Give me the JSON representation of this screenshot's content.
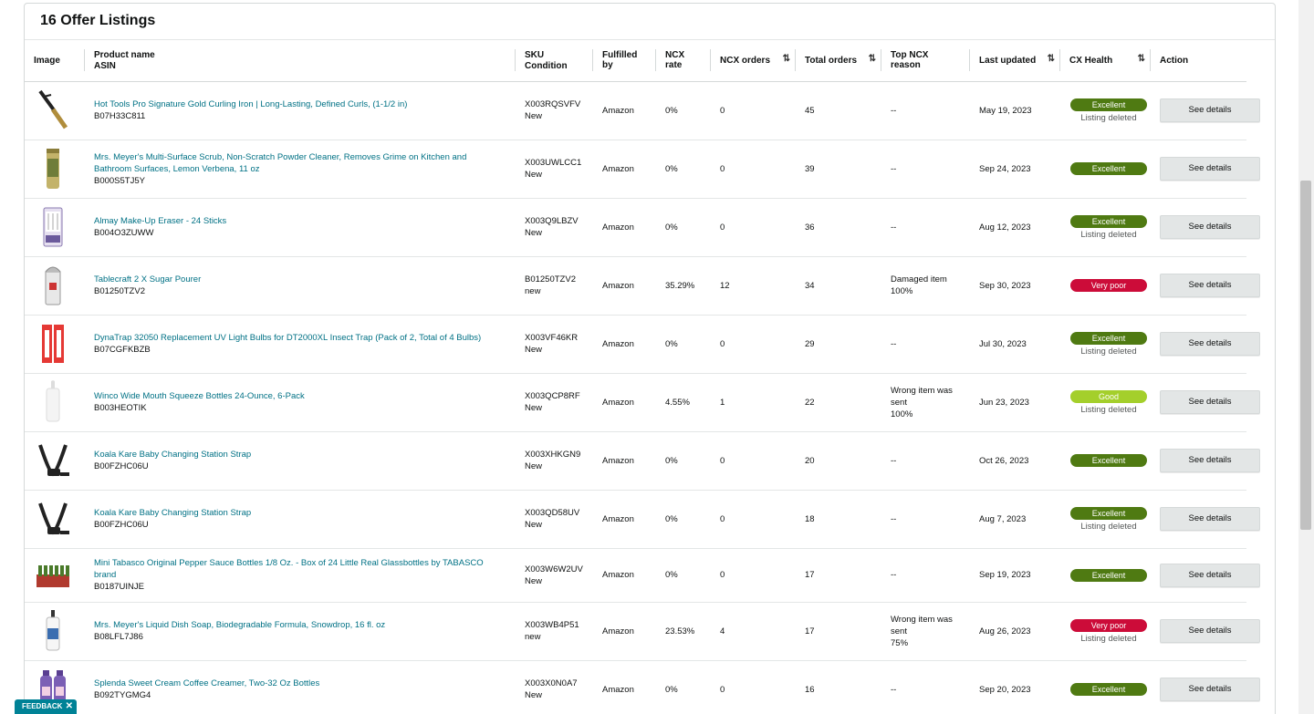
{
  "panel": {
    "title": "16 Offer Listings"
  },
  "columns": {
    "image": "Image",
    "product_name": "Product name",
    "asin": "ASIN",
    "sku": "SKU",
    "condition": "Condition",
    "fulfilled_by": "Fulfilled by",
    "ncx_rate": "NCX rate",
    "ncx_orders": "NCX orders",
    "total_orders": "Total orders",
    "top_ncx_reason": "Top NCX reason",
    "last_updated": "Last updated",
    "cx_health": "CX Health",
    "action": "Action",
    "sort_icon": "⇅"
  },
  "rows": [
    {
      "image_icon": "curling-iron",
      "name": "Hot Tools Pro Signature Gold Curling Iron | Long-Lasting, Defined Curls, (1-1/2 in)",
      "asin": "B07H33C811",
      "sku": "X003RQSVFV",
      "condition": "New",
      "fulfilled": "Amazon",
      "ncx_rate": "0%",
      "ncx_orders": "0",
      "total_orders": "45",
      "reason": "--",
      "reason2": "",
      "reason3": "",
      "updated": "May 19, 2023",
      "health": "Excellent",
      "health_class": "excellent",
      "health_sub": "Listing deleted",
      "action": "See details"
    },
    {
      "image_icon": "cleaner-can",
      "name": "Mrs. Meyer's Multi-Surface Scrub, Non-Scratch Powder Cleaner, Removes Grime on Kitchen and Bathroom Surfaces, Lemon Verbena, 11 oz",
      "asin": "B000S5TJ5Y",
      "sku": "X003UWLCC1",
      "condition": "New",
      "fulfilled": "Amazon",
      "ncx_rate": "0%",
      "ncx_orders": "0",
      "total_orders": "39",
      "reason": "--",
      "reason2": "",
      "reason3": "",
      "updated": "Sep 24, 2023",
      "health": "Excellent",
      "health_class": "excellent",
      "health_sub": "",
      "action": "See details"
    },
    {
      "image_icon": "makeup-eraser",
      "name": "Almay Make-Up Eraser - 24 Sticks",
      "asin": "B004O3ZUWW",
      "sku": "X003Q9LBZV",
      "condition": "New",
      "fulfilled": "Amazon",
      "ncx_rate": "0%",
      "ncx_orders": "0",
      "total_orders": "36",
      "reason": "--",
      "reason2": "",
      "reason3": "",
      "updated": "Aug 12, 2023",
      "health": "Excellent",
      "health_class": "excellent",
      "health_sub": "Listing deleted",
      "action": "See details"
    },
    {
      "image_icon": "sugar-pourer",
      "name": "Tablecraft 2 X Sugar Pourer",
      "asin": "B01250TZV2",
      "sku": "B01250TZV2",
      "condition": "new",
      "fulfilled": "Amazon",
      "ncx_rate": "35.29%",
      "ncx_orders": "12",
      "total_orders": "34",
      "reason": "Damaged item",
      "reason2": "100%",
      "reason3": "",
      "updated": "Sep 30, 2023",
      "health": "Very poor",
      "health_class": "verypoor",
      "health_sub": "",
      "action": "See details"
    },
    {
      "image_icon": "uv-bulbs",
      "name": "DynaTrap 32050 Replacement UV Light Bulbs for DT2000XL Insect Trap (Pack of 2, Total of 4 Bulbs)",
      "asin": "B07CGFKBZB",
      "sku": "X003VF46KR",
      "condition": "New",
      "fulfilled": "Amazon",
      "ncx_rate": "0%",
      "ncx_orders": "0",
      "total_orders": "29",
      "reason": "--",
      "reason2": "",
      "reason3": "",
      "updated": "Jul 30, 2023",
      "health": "Excellent",
      "health_class": "excellent",
      "health_sub": "Listing deleted",
      "action": "See details"
    },
    {
      "image_icon": "squeeze-bottle",
      "name": "Winco Wide Mouth Squeeze Bottles 24-Ounce, 6-Pack",
      "asin": "B003HEOTIK",
      "sku": "X003QCP8RF",
      "condition": "New",
      "fulfilled": "Amazon",
      "ncx_rate": "4.55%",
      "ncx_orders": "1",
      "total_orders": "22",
      "reason": "Wrong item was",
      "reason2": "sent",
      "reason3": "100%",
      "updated": "Jun 23, 2023",
      "health": "Good",
      "health_class": "good",
      "health_sub": "Listing deleted",
      "action": "See details"
    },
    {
      "image_icon": "changing-strap",
      "name": "Koala Kare Baby Changing Station Strap",
      "asin": "B00FZHC06U",
      "sku": "X003XHKGN9",
      "condition": "New",
      "fulfilled": "Amazon",
      "ncx_rate": "0%",
      "ncx_orders": "0",
      "total_orders": "20",
      "reason": "--",
      "reason2": "",
      "reason3": "",
      "updated": "Oct 26, 2023",
      "health": "Excellent",
      "health_class": "excellent",
      "health_sub": "",
      "action": "See details"
    },
    {
      "image_icon": "changing-strap",
      "name": "Koala Kare Baby Changing Station Strap",
      "asin": "B00FZHC06U",
      "sku": "X003QD58UV",
      "condition": "New",
      "fulfilled": "Amazon",
      "ncx_rate": "0%",
      "ncx_orders": "0",
      "total_orders": "18",
      "reason": "--",
      "reason2": "",
      "reason3": "",
      "updated": "Aug 7, 2023",
      "health": "Excellent",
      "health_class": "excellent",
      "health_sub": "Listing deleted",
      "action": "See details"
    },
    {
      "image_icon": "sauce-bottles",
      "name": "Mini Tabasco Original Pepper Sauce Bottles 1/8 Oz. - Box of 24 Little Real Glassbottles by TABASCO brand",
      "asin": "B0187UINJE",
      "sku": "X003W6W2UV",
      "condition": "New",
      "fulfilled": "Amazon",
      "ncx_rate": "0%",
      "ncx_orders": "0",
      "total_orders": "17",
      "reason": "--",
      "reason2": "",
      "reason3": "",
      "updated": "Sep 19, 2023",
      "health": "Excellent",
      "health_class": "excellent",
      "health_sub": "",
      "action": "See details"
    },
    {
      "image_icon": "dish-soap",
      "name": "Mrs. Meyer's Liquid Dish Soap, Biodegradable Formula, Snowdrop, 16 fl. oz",
      "asin": "B08LFL7J86",
      "sku": "X003WB4P51",
      "condition": "new",
      "fulfilled": "Amazon",
      "ncx_rate": "23.53%",
      "ncx_orders": "4",
      "total_orders": "17",
      "reason": "Wrong item was",
      "reason2": "sent",
      "reason3": "75%",
      "updated": "Aug 26, 2023",
      "health": "Very poor",
      "health_class": "verypoor",
      "health_sub": "Listing deleted",
      "action": "See details"
    },
    {
      "image_icon": "creamer-bottles",
      "name": "Splenda Sweet Cream Coffee Creamer, Two-32 Oz Bottles",
      "asin": "B092TYGMG4",
      "sku": "X003X0N0A7",
      "condition": "New",
      "fulfilled": "Amazon",
      "ncx_rate": "0%",
      "ncx_orders": "0",
      "total_orders": "16",
      "reason": "--",
      "reason2": "",
      "reason3": "",
      "updated": "Sep 20, 2023",
      "health": "Excellent",
      "health_class": "excellent",
      "health_sub": "",
      "action": "See details"
    }
  ],
  "feedback": {
    "label": "FEEDBACK",
    "close": "✕"
  },
  "colors": {
    "link": "#007185",
    "excellent": "#4f7a12",
    "very_poor": "#cc0c39",
    "good": "#a4cf2b",
    "feedback": "#008296"
  }
}
